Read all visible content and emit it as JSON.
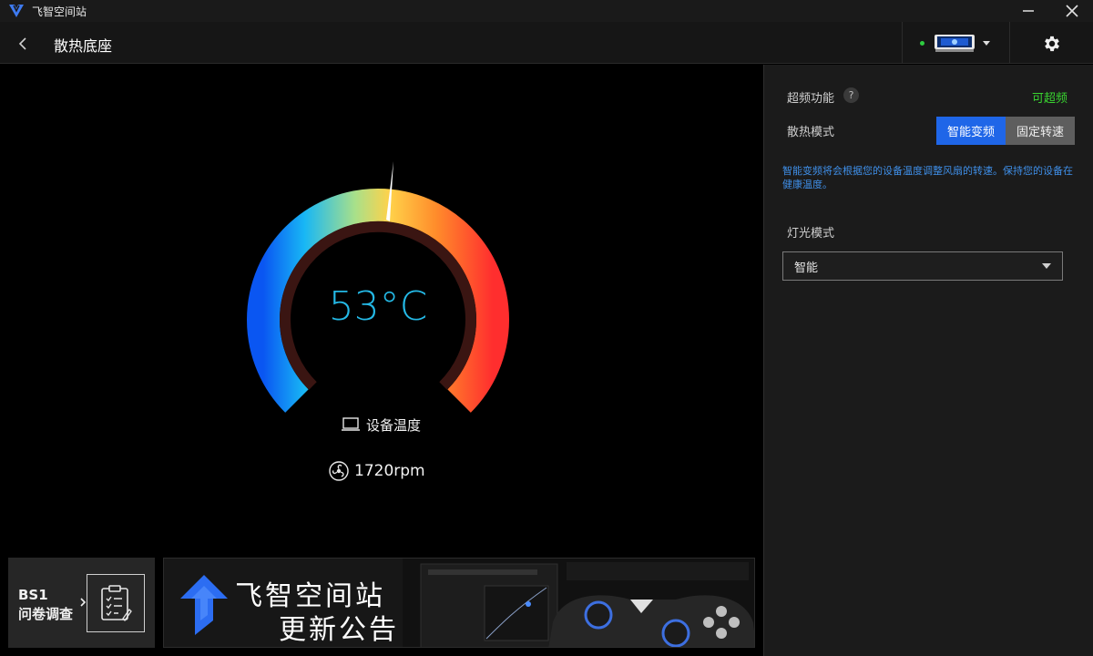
{
  "app": {
    "title": "飞智空间站"
  },
  "header": {
    "title": "散热底座"
  },
  "device": {
    "connected": true,
    "status_color": "#2ecc40"
  },
  "gauge": {
    "temperature": "53°C",
    "temperature_value": 53,
    "sensor_label": "设备温度",
    "fan_speed": "1720rpm",
    "accent_color": "#24b9e6"
  },
  "survey": {
    "title": "BS1",
    "subtitle": "问卷调查"
  },
  "banner": {
    "line1": "飞智空间站",
    "line2": "更新公告"
  },
  "panel": {
    "overclock_label": "超频功能",
    "overclock_help": "?",
    "overclock_status": "可超频",
    "cooling_mode_label": "散热模式",
    "modes": [
      "智能变频",
      "固定转速"
    ],
    "active_mode": "智能变频",
    "mode_description": "智能变频将会根据您的设备温度调整风扇的转速。保持您的设备在健康温度。",
    "light_mode_label": "灯光模式",
    "light_mode_value": "智能"
  },
  "colors": {
    "accent_blue": "#1f66e8",
    "status_green": "#39d430",
    "desc_blue": "#3f8fe8"
  },
  "icons": {
    "logo": "feizhi-logo-icon",
    "back": "chevron-left-icon",
    "settings": "gear-icon",
    "laptop": "laptop-icon",
    "fan": "fan-icon",
    "survey": "clipboard-icon"
  }
}
